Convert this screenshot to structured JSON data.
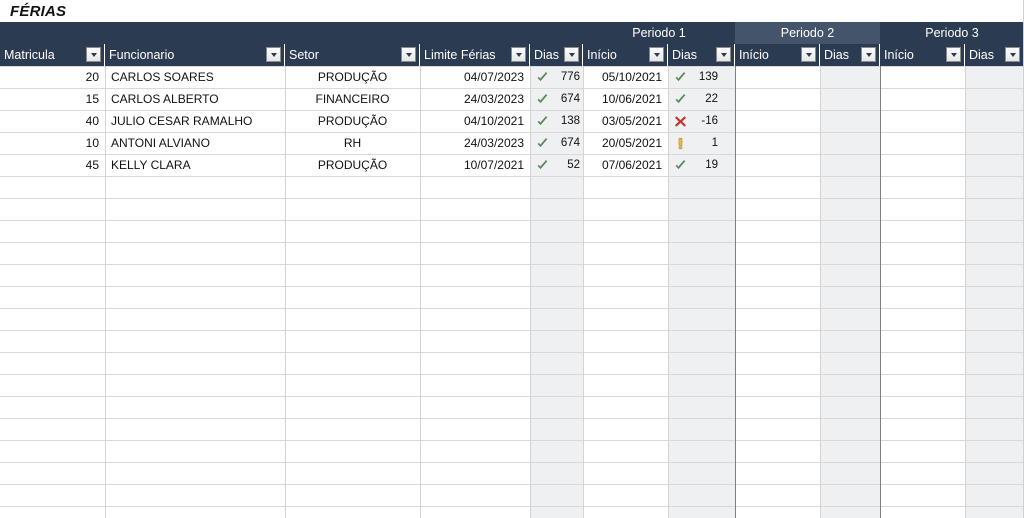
{
  "document": {
    "title": "FÉRIAS"
  },
  "colors": {
    "header_navy": "#2b3b52",
    "header_highlight": "#44546a",
    "shade_column": "#eef0f1",
    "ok": "#5a8a5a",
    "error": "#c0392b",
    "warning": "#e8b84b",
    "grid_line": "#d9d9d9",
    "group_separator": "#7f7f7f"
  },
  "group_headers": [
    {
      "label": "",
      "name": "group-blank"
    },
    {
      "label": "Periodo 1",
      "name": "group-periodo-1",
      "highlight": false
    },
    {
      "label": "Periodo 2",
      "name": "group-periodo-2",
      "highlight": true
    },
    {
      "label": "Periodo 3",
      "name": "group-periodo-3",
      "highlight": false
    }
  ],
  "columns": [
    {
      "label": "Matricula",
      "name": "col-matricula",
      "align": "right",
      "filter": true
    },
    {
      "label": "Funcionario",
      "name": "col-funcionario",
      "align": "left",
      "filter": true
    },
    {
      "label": "Setor",
      "name": "col-setor",
      "align": "center",
      "filter": true
    },
    {
      "label": "Limite Férias",
      "name": "col-limite-ferias",
      "align": "right",
      "filter": true
    },
    {
      "label": "Dias",
      "name": "col-dias-limite",
      "align": "icon",
      "filter": true,
      "shaded": true
    },
    {
      "label": "Início",
      "name": "col-inicio-p1",
      "align": "right",
      "filter": true
    },
    {
      "label": "Dias",
      "name": "col-dias-p1",
      "align": "icon",
      "filter": true,
      "shaded": true
    },
    {
      "label": "Início",
      "name": "col-inicio-p2",
      "align": "right",
      "filter": true
    },
    {
      "label": "Dias",
      "name": "col-dias-p2",
      "align": "icon",
      "filter": true,
      "shaded": true
    },
    {
      "label": "Início",
      "name": "col-inicio-p3",
      "align": "right",
      "filter": true
    },
    {
      "label": "Dias",
      "name": "col-dias-p3",
      "align": "icon",
      "filter": true,
      "shaded": true
    }
  ],
  "rows": [
    {
      "matricula": "20",
      "funcionario": "CARLOS SOARES",
      "setor": "PRODUÇÃO",
      "limite_ferias": "04/07/2023",
      "dias_limite": {
        "value": "776",
        "icon": "check-icon"
      },
      "inicio_p1": "05/10/2021",
      "dias_p1": {
        "value": "139",
        "icon": "check-icon"
      },
      "inicio_p2": "",
      "dias_p2": {
        "value": "",
        "icon": ""
      },
      "inicio_p3": "",
      "dias_p3": {
        "value": "",
        "icon": ""
      }
    },
    {
      "matricula": "15",
      "funcionario": "CARLOS ALBERTO",
      "setor": "FINANCEIRO",
      "limite_ferias": "24/03/2023",
      "dias_limite": {
        "value": "674",
        "icon": "check-icon"
      },
      "inicio_p1": "10/06/2021",
      "dias_p1": {
        "value": "22",
        "icon": "check-icon"
      },
      "inicio_p2": "",
      "dias_p2": {
        "value": "",
        "icon": ""
      },
      "inicio_p3": "",
      "dias_p3": {
        "value": "",
        "icon": ""
      }
    },
    {
      "matricula": "40",
      "funcionario": "JULIO CESAR RAMALHO",
      "setor": "PRODUÇÃO",
      "limite_ferias": "04/10/2021",
      "dias_limite": {
        "value": "138",
        "icon": "check-icon"
      },
      "inicio_p1": "03/05/2021",
      "dias_p1": {
        "value": "-16",
        "icon": "cross-icon"
      },
      "inicio_p2": "",
      "dias_p2": {
        "value": "",
        "icon": ""
      },
      "inicio_p3": "",
      "dias_p3": {
        "value": "",
        "icon": ""
      }
    },
    {
      "matricula": "10",
      "funcionario": "ANTONI ALVIANO",
      "setor": "RH",
      "limite_ferias": "24/03/2023",
      "dias_limite": {
        "value": "674",
        "icon": "check-icon"
      },
      "inicio_p1": "20/05/2021",
      "dias_p1": {
        "value": "1",
        "icon": "warning-icon"
      },
      "inicio_p2": "",
      "dias_p2": {
        "value": "",
        "icon": ""
      },
      "inicio_p3": "",
      "dias_p3": {
        "value": "",
        "icon": ""
      }
    },
    {
      "matricula": "45",
      "funcionario": "KELLY CLARA",
      "setor": "PRODUÇÃO",
      "limite_ferias": "10/07/2021",
      "dias_limite": {
        "value": "52",
        "icon": "check-icon"
      },
      "inicio_p1": "07/06/2021",
      "dias_p1": {
        "value": "19",
        "icon": "check-icon"
      },
      "inicio_p2": "",
      "dias_p2": {
        "value": "",
        "icon": ""
      },
      "inicio_p3": "",
      "dias_p3": {
        "value": "",
        "icon": ""
      }
    }
  ]
}
